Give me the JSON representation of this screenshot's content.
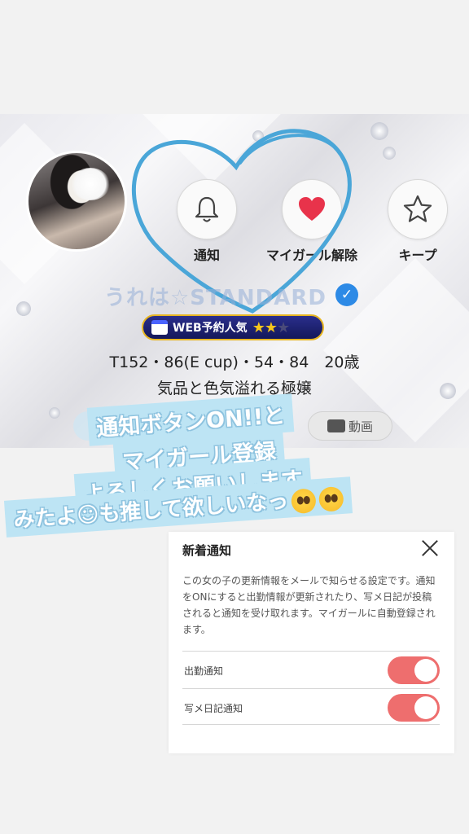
{
  "profile": {
    "name": "うれは☆STANDARD",
    "badge_text": "WEB予約人気",
    "badge_stars_filled": 2,
    "badge_stars_total": 3,
    "stats": "T152・86(E cup)・54・84　20歳",
    "tagline": "気品と色気溢れる極嬢",
    "video_label": "動画"
  },
  "actions": [
    {
      "label": "通知",
      "icon": "bell-icon"
    },
    {
      "label": "マイガール解除",
      "icon": "heart-icon"
    },
    {
      "label": "キープ",
      "icon": "star-icon"
    }
  ],
  "caption": {
    "line1": "通知ボタンON!!と",
    "line2": "マイガール登録",
    "line3": "よろしくお願いします",
    "line4": "みたよ☺も推して欲しいなっ"
  },
  "panel": {
    "title": "新着通知",
    "description": "この女の子の更新情報をメールで知らせる設定です。通知をONにすると出勤情報が更新されたり、写メ日記が投稿されると通知を受け取れます。マイガールに自動登録されます。",
    "settings": [
      {
        "label": "出勤通知",
        "on": true
      },
      {
        "label": "写メ日記通知",
        "on": true
      }
    ]
  },
  "colors": {
    "accent_heart": "#e8334b",
    "toggle_on": "#ee6e6e",
    "verified": "#2d8ae6",
    "caption_bg": "#bde4f4"
  }
}
